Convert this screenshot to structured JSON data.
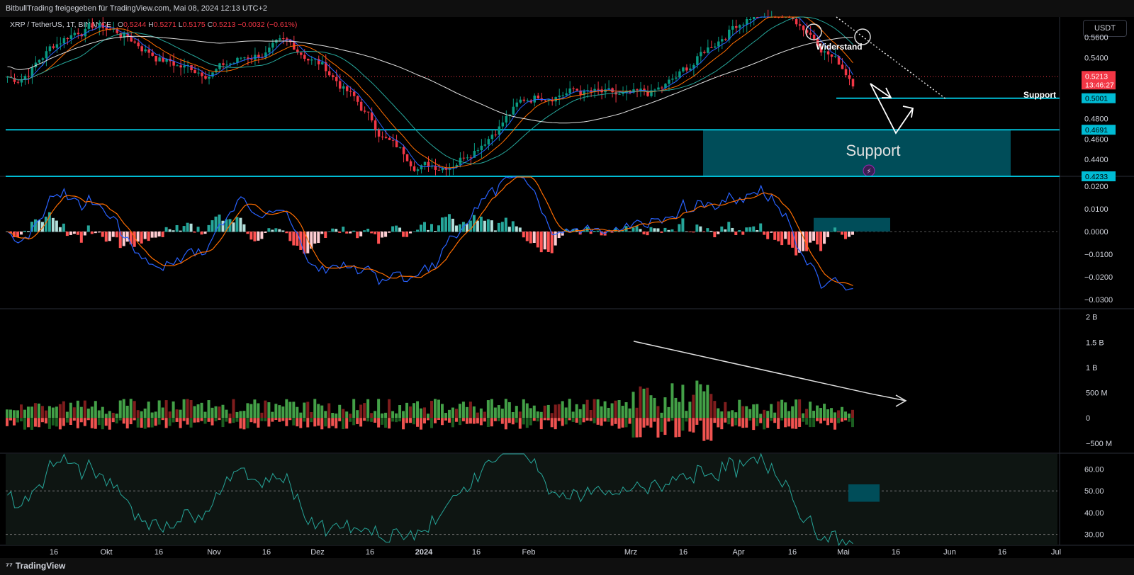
{
  "header": {
    "share_text": "BitbullTrading freigegeben für TradingView.com, Mai 08, 2024 12:13 UTC+2"
  },
  "legend": {
    "symbol": "XRP / TetherUS, 1T, BINANCE",
    "o_label": "O",
    "o": "0.5244",
    "h_label": "H",
    "h": "0.5271",
    "l_label": "L",
    "l": "0.5175",
    "c_label": "C",
    "c": "0.5213",
    "change": "−0.0032 (−0.61%)"
  },
  "unit_button": "USDT",
  "footer": {
    "brand": "TradingView"
  },
  "chart_data": {
    "type": "candlestick",
    "panes": [
      {
        "name": "price",
        "y_ticks": [
          "0.5600",
          "0.5400",
          "0.4800",
          "0.4600",
          "0.4400"
        ],
        "ylim": [
          0.4233,
          0.58
        ],
        "price_labels": [
          {
            "value": "0.5213",
            "sub": "13:46:27",
            "color": "#f23645"
          },
          {
            "value": "0.5001",
            "color": "#00bcd4"
          },
          {
            "value": "0.4691",
            "color": "#00bcd4"
          },
          {
            "value": "0.4233",
            "color": "#00bcd4"
          }
        ],
        "horizontal_levels": [
          0.5001,
          0.4691,
          0.4233
        ],
        "support_zone": {
          "top": 0.4691,
          "bottom": 0.4233,
          "label": "Support"
        },
        "annotations": [
          "Widerstand",
          "Support"
        ],
        "series": [
          {
            "name": "",
            "color": "#2962ff"
          },
          {
            "name": "",
            "color": "#ff6d00"
          },
          {
            "name": "",
            "color": "#26a69a"
          },
          {
            "name": "",
            "color": "#e0e0e0"
          }
        ]
      },
      {
        "name": "macd",
        "y_ticks": [
          "0.0200",
          "0.0100",
          "0.0000",
          "−0.0100",
          "−0.0200",
          "−0.0300"
        ],
        "ylim": [
          -0.034,
          0.024
        ]
      },
      {
        "name": "volume",
        "y_ticks": [
          "2 B",
          "1.5 B",
          "1 B",
          "500 M",
          "0",
          "−500 M"
        ],
        "ylim": [
          -700,
          2150
        ]
      },
      {
        "name": "rsi",
        "y_ticks": [
          "60.00",
          "50.00",
          "40.00",
          "30.00"
        ],
        "ylim": [
          25,
          67
        ],
        "bands": [
          50,
          30
        ]
      }
    ],
    "x_ticks": [
      "16",
      "Okt",
      "16",
      "Nov",
      "16",
      "Dez",
      "16",
      "2024",
      "16",
      "Feb",
      "Mrz",
      "16",
      "Apr",
      "16",
      "Mai",
      "16",
      "Jun",
      "16",
      "Jul"
    ]
  }
}
